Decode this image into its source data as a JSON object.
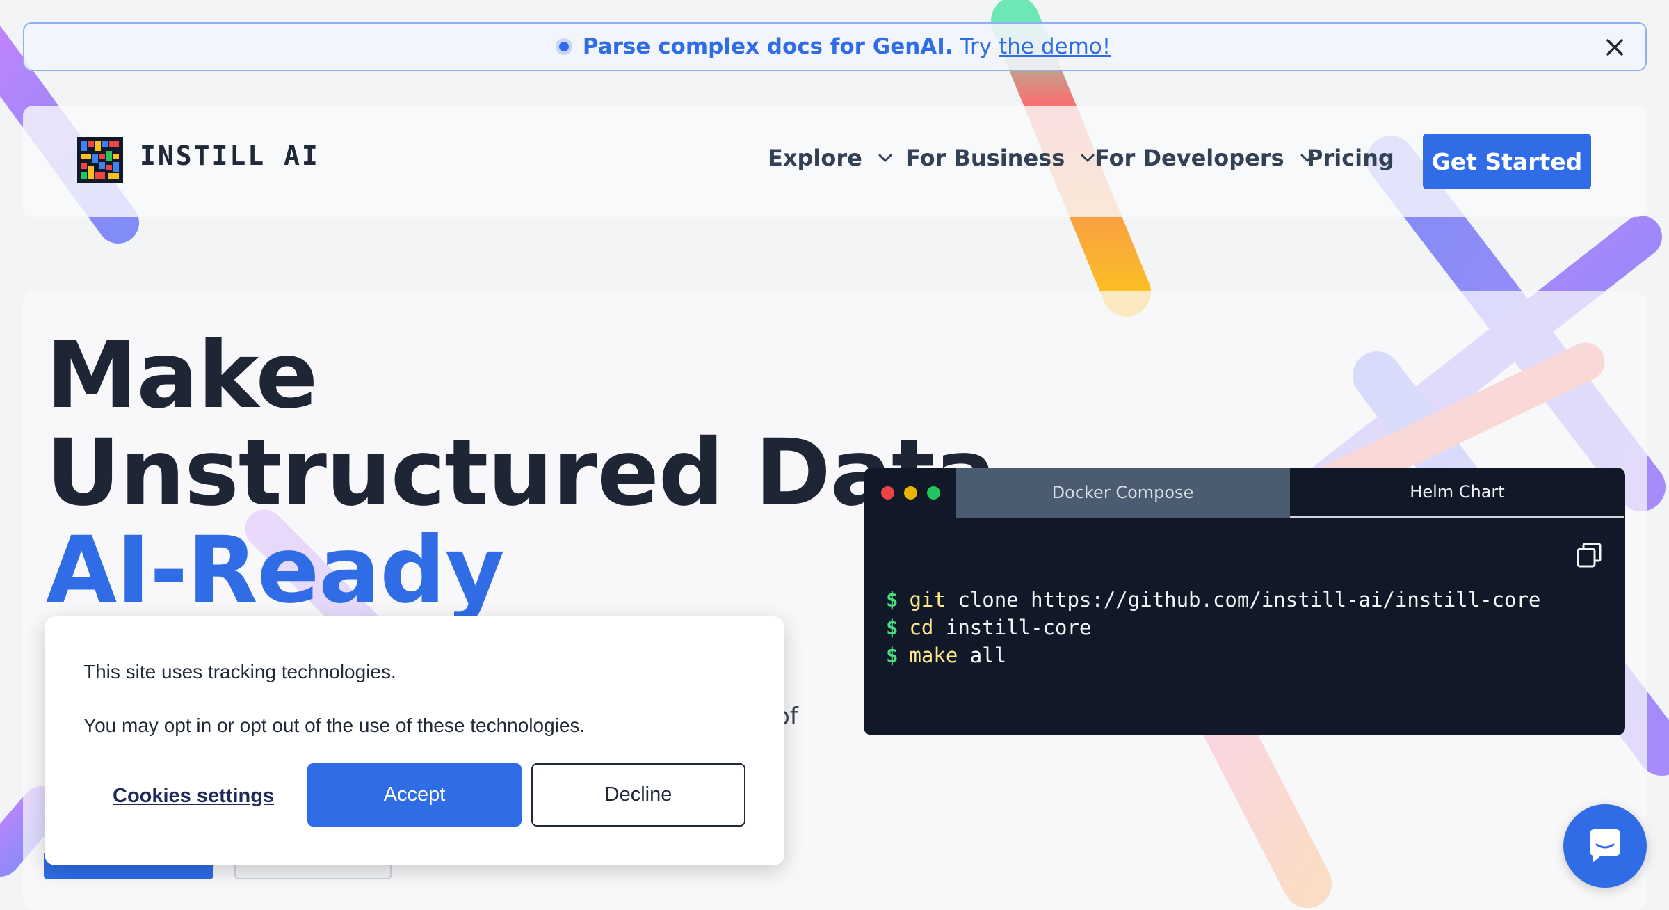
{
  "banner": {
    "bold_text": "Parse complex docs for GenAI.",
    "try_text": "Try",
    "link_text": "the demo!",
    "close_icon": "close-icon"
  },
  "brand": {
    "name": "INSTILL AI"
  },
  "nav": {
    "items": [
      {
        "label": "Explore",
        "has_dropdown": true
      },
      {
        "label": "For Business",
        "has_dropdown": true
      },
      {
        "label": "For Developers",
        "has_dropdown": true
      },
      {
        "label": "Pricing",
        "has_dropdown": false
      }
    ],
    "cta_label": "Get Started"
  },
  "hero": {
    "line1": "Make",
    "line2": "Unstructured Data",
    "line3": "AI-Ready",
    "partial_text": "of"
  },
  "terminal": {
    "tabs": [
      {
        "label": "Docker Compose",
        "active": true
      },
      {
        "label": "Helm Chart",
        "active": false
      }
    ],
    "lines": [
      {
        "prompt": "$",
        "cmd": "git",
        "args": "clone https://github.com/instill-ai/instill-core"
      },
      {
        "prompt": "$",
        "cmd": "cd",
        "args": "instill-core"
      },
      {
        "prompt": "$",
        "cmd": "make",
        "args": "all"
      }
    ],
    "copy_icon": "copy-icon"
  },
  "cookie": {
    "message1": "This site uses tracking technologies.",
    "message2": "You may opt in or opt out of the use of these technologies.",
    "settings_label": "Cookies settings",
    "accept_label": "Accept",
    "decline_label": "Decline"
  },
  "chat": {
    "icon": "chat-icon"
  },
  "colors": {
    "accent": "#2f6ce5",
    "heading": "#1e2535",
    "terminal_bg": "#111827",
    "prompt_green": "#4ade80",
    "cmd_yellow": "#fde68a"
  }
}
